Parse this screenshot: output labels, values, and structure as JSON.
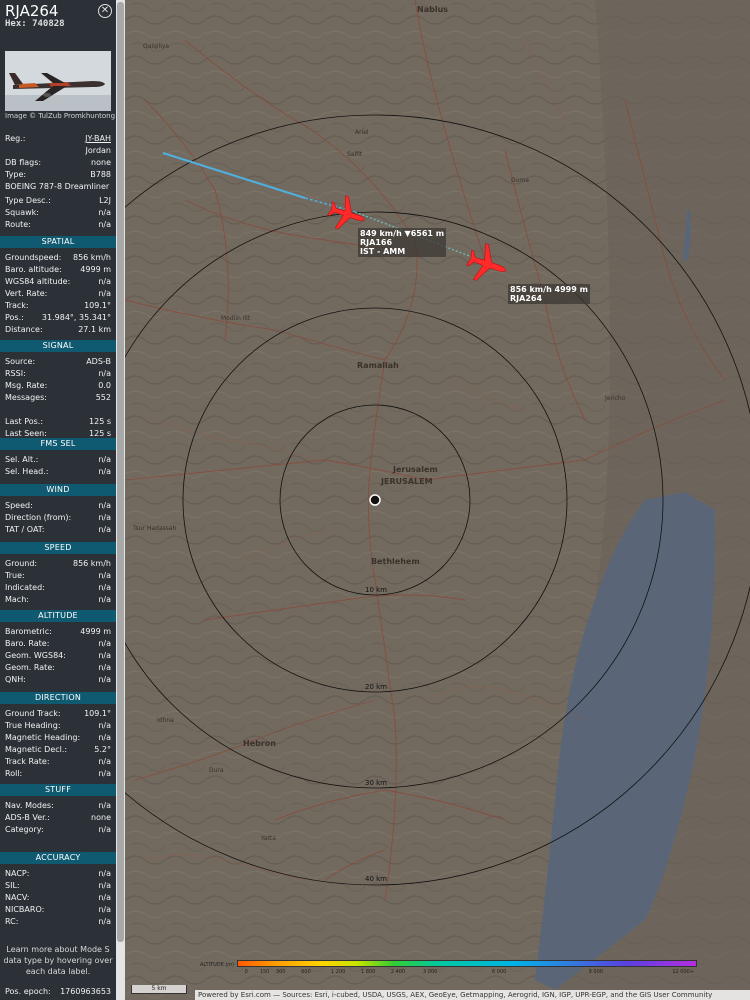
{
  "aircraft": {
    "callsign": "RJA264",
    "hex_label": "Hex: 740828",
    "photo_credit": "Image © TulZub Promkhuntong"
  },
  "info": [
    {
      "label": "Reg.:",
      "value": "JY-BAH",
      "link": true
    },
    {
      "label": "",
      "value": "Jordan"
    },
    {
      "label": "DB flags:",
      "value": "none"
    },
    {
      "label": "Type:",
      "value": "B788"
    },
    {
      "label": "",
      "value": "BOEING 787-8 Dreamliner",
      "left": true
    },
    {
      "label": "Type Desc.:",
      "value": "L2J"
    },
    {
      "label": "Squawk:",
      "value": "n/a"
    },
    {
      "label": "Route:",
      "value": "n/a"
    }
  ],
  "sections": [
    {
      "title": "SPATIAL",
      "rows": [
        {
          "label": "Groundspeed:",
          "value": "856 km/h"
        },
        {
          "label": "Baro. altitude:",
          "value": "4999 m"
        },
        {
          "label": "WGS84 altitude:",
          "value": "n/a"
        },
        {
          "label": "Vert. Rate:",
          "value": "n/a"
        },
        {
          "label": "Track:",
          "value": "109.1°"
        },
        {
          "label": "Pos.:",
          "value": "31.984°, 35.341°"
        },
        {
          "label": "Distance:",
          "value": "27.1 km"
        }
      ]
    },
    {
      "title": "SIGNAL",
      "rows": [
        {
          "label": "Source:",
          "value": "ADS-B"
        },
        {
          "label": "RSSI:",
          "value": "n/a"
        },
        {
          "label": "Msg. Rate:",
          "value": "0.0"
        },
        {
          "label": "Messages:",
          "value": "552"
        },
        {
          "label": "",
          "value": ""
        },
        {
          "label": "Last Pos.:",
          "value": "125 s"
        },
        {
          "label": "Last Seen:",
          "value": "125 s"
        }
      ]
    },
    {
      "title": "FMS SEL",
      "rows": [
        {
          "label": "Sel. Alt.:",
          "value": "n/a"
        },
        {
          "label": "Sel. Head.:",
          "value": "n/a"
        }
      ]
    },
    {
      "title": "WIND",
      "rows": [
        {
          "label": "Speed:",
          "value": "n/a"
        },
        {
          "label": "Direction (from):",
          "value": "n/a"
        },
        {
          "label": "TAT / OAT:",
          "value": "n/a"
        }
      ]
    },
    {
      "title": "SPEED",
      "rows": [
        {
          "label": "Ground:",
          "value": "856 km/h"
        },
        {
          "label": "True:",
          "value": "n/a"
        },
        {
          "label": "Indicated:",
          "value": "n/a"
        },
        {
          "label": "Mach:",
          "value": "n/a"
        }
      ]
    },
    {
      "title": "ALTITUDE",
      "rows": [
        {
          "label": "Barometric:",
          "value": "4999 m"
        },
        {
          "label": "Baro. Rate:",
          "value": "n/a"
        },
        {
          "label": "Geom. WGS84:",
          "value": "n/a"
        },
        {
          "label": "Geom. Rate:",
          "value": "n/a"
        },
        {
          "label": "QNH:",
          "value": "n/a"
        }
      ]
    },
    {
      "title": "DIRECTION",
      "rows": [
        {
          "label": "Ground Track:",
          "value": "109.1°"
        },
        {
          "label": "True Heading:",
          "value": "n/a"
        },
        {
          "label": "Magnetic Heading:",
          "value": "n/a"
        },
        {
          "label": "Magnetic Decl.:",
          "value": "5.2°"
        },
        {
          "label": "Track Rate:",
          "value": "n/a"
        },
        {
          "label": "Roll:",
          "value": "n/a"
        }
      ]
    },
    {
      "title": "STUFF",
      "rows": [
        {
          "label": "Nav. Modes:",
          "value": "n/a"
        },
        {
          "label": "ADS-B Ver.:",
          "value": "none"
        },
        {
          "label": "Category:",
          "value": "n/a"
        }
      ]
    },
    {
      "title": "ACCURACY",
      "rows": [
        {
          "label": "NACP:",
          "value": "n/a"
        },
        {
          "label": "SIL:",
          "value": "n/a"
        },
        {
          "label": "NACV:",
          "value": "n/a"
        },
        {
          "label": "NICBARO:",
          "value": "n/a"
        },
        {
          "label": "RC:",
          "value": "n/a"
        }
      ]
    }
  ],
  "learn_more": "Learn more about Mode S data type by hovering over each data label.",
  "pos_epoch": {
    "label": "Pos. epoch:",
    "value": "1760963653"
  },
  "map": {
    "aircraft_labels": [
      {
        "line1": "849 km/h  ▼6561 m",
        "line2": "RJA166",
        "line3": "IST - AMM"
      },
      {
        "line1": "856 km/h  4999 m",
        "line2": "RJA264"
      }
    ],
    "ring_labels": [
      "10 km",
      "20 km",
      "30 km",
      "40 km"
    ],
    "places": [
      {
        "name": "Nablus"
      },
      {
        "name": "Qalqiliya"
      },
      {
        "name": "Ariel"
      },
      {
        "name": "Salfit"
      },
      {
        "name": "Duma"
      },
      {
        "name": "Ramallah"
      },
      {
        "name": "Jericho"
      },
      {
        "name": "Jerusalem"
      },
      {
        "name": "JERUSALEM"
      },
      {
        "name": "Bethlehem"
      },
      {
        "name": "Hebron"
      },
      {
        "name": "Yatta"
      },
      {
        "name": "Dura"
      },
      {
        "name": "Idhna"
      },
      {
        "name": "Modiin Ilit"
      },
      {
        "name": "Tsur Hadassah"
      }
    ],
    "legend_title": "ALTITUDE (m)",
    "legend_ticks": [
      "0",
      "150",
      "300",
      "600",
      "1 200",
      "1 800",
      "2 400",
      "3 000",
      "6 000",
      "9 000",
      "12 000+"
    ],
    "scale": "5 km",
    "attribution": "Powered by Esri.com — Sources: Esri, i-cubed, USDA, USGS, AEX, GeoEye, Getmapping, Aerogrid, IGN, IGP, UPR-EGP, and the GIS User Community",
    "colors": {
      "track": "#4fb0e0",
      "aircraft": "#ff2a2a",
      "sea": "#5a6678"
    }
  }
}
